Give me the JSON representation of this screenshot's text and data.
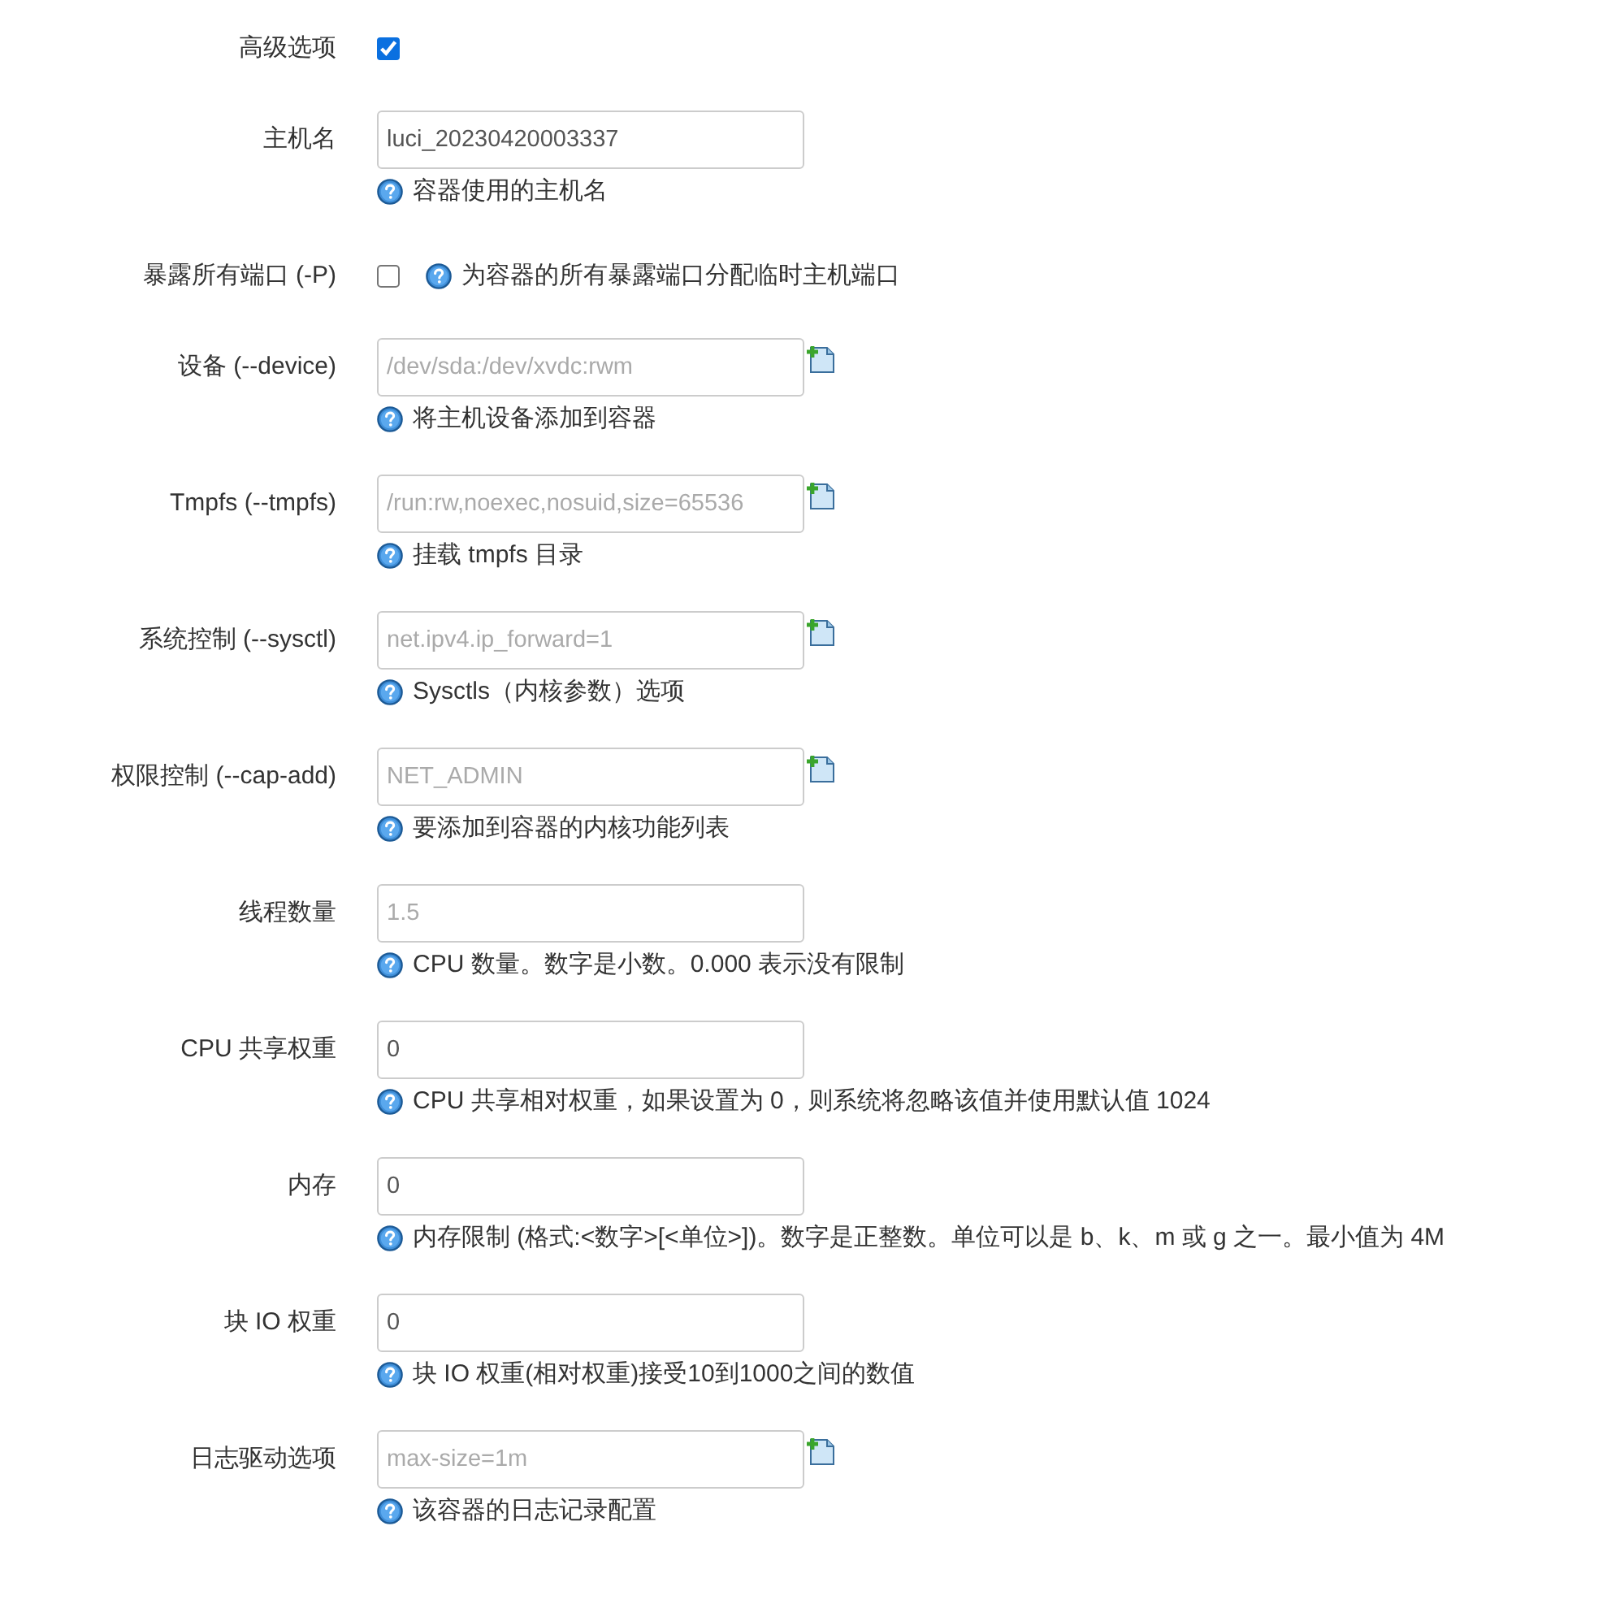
{
  "fields": [
    {
      "kind": "checkbox",
      "label": "高级选项",
      "checked": true
    },
    {
      "kind": "input",
      "label": "主机名",
      "value": "luci_20230420003337",
      "help": "容器使用的主机名",
      "addable": false
    },
    {
      "kind": "checkbox",
      "label": "暴露所有端口 (-P)",
      "checked": false,
      "help": "为容器的所有暴露端口分配临时主机端口"
    },
    {
      "kind": "input",
      "label": "设备 (--device)",
      "placeholder": "/dev/sda:/dev/xvdc:rwm",
      "help": "将主机设备添加到容器",
      "addable": true
    },
    {
      "kind": "input",
      "label": "Tmpfs (--tmpfs)",
      "placeholder": "/run:rw,noexec,nosuid,size=65536",
      "help": "挂载 tmpfs 目录",
      "addable": true
    },
    {
      "kind": "input",
      "label": "系统控制 (--sysctl)",
      "placeholder": "net.ipv4.ip_forward=1",
      "help": "Sysctls（内核参数）选项",
      "addable": true
    },
    {
      "kind": "input",
      "label": "权限控制 (--cap-add)",
      "placeholder": "NET_ADMIN",
      "help": "要添加到容器的内核功能列表",
      "addable": true
    },
    {
      "kind": "input",
      "label": "线程数量",
      "placeholder": "1.5",
      "help": "CPU 数量。数字是小数。0.000 表示没有限制",
      "addable": false
    },
    {
      "kind": "input",
      "label": "CPU 共享权重",
      "value": "0",
      "help": "CPU 共享相对权重，如果设置为 0，则系统将忽略该值并使用默认值 1024",
      "addable": false
    },
    {
      "kind": "input",
      "label": "内存",
      "value": "0",
      "help": "内存限制 (格式:<数字>[<单位>])。数字是正整数。单位可以是 b、k、m 或 g 之一。最小值为 4M",
      "addable": false
    },
    {
      "kind": "input",
      "label": "块 IO 权重",
      "value": "0",
      "help": "块 IO 权重(相对权重)接受10到1000之间的数值",
      "addable": false
    },
    {
      "kind": "input",
      "label": "日志驱动选项",
      "placeholder": "max-size=1m",
      "help": "该容器的日志记录配置",
      "addable": true
    }
  ]
}
